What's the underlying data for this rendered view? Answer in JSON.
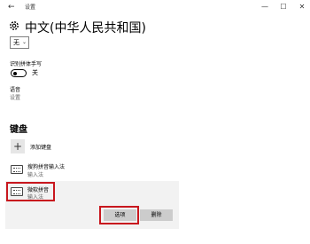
{
  "window": {
    "back_glyph": "←",
    "title": "设置",
    "minimize_glyph": "—",
    "maximize_glyph": "☐",
    "close_glyph": "✕"
  },
  "page": {
    "title": "中文(中华人民共和国)",
    "dropdown_value": "无"
  },
  "handwriting": {
    "label": "识别拼体手写",
    "toggle_state": "关",
    "toggle_on": false
  },
  "voice": {
    "label": "语音",
    "link": "设置"
  },
  "keyboards": {
    "section_title": "键盘",
    "add_label": "添加键盘",
    "add_glyph": "+",
    "items": [
      {
        "name": "搜狗拼音输入法",
        "type": "输入法"
      },
      {
        "name": "微软拼音",
        "type": "输入法"
      }
    ],
    "options_button": "选项",
    "delete_button": "删除"
  },
  "colors": {
    "highlight_red": "#c8171e",
    "panel_bg": "#f2f2f2",
    "button_bg": "#cccccc"
  }
}
